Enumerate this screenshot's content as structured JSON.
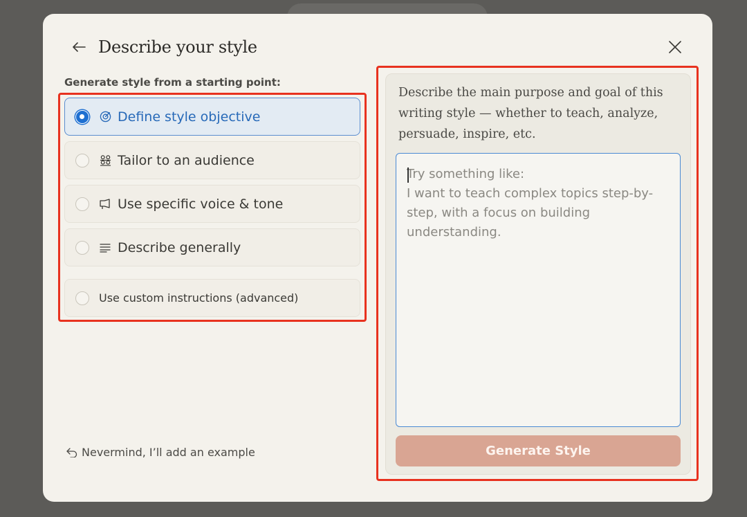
{
  "header": {
    "title": "Describe your style",
    "back_icon": "arrow-left-icon",
    "close_icon": "close-icon"
  },
  "left": {
    "section_label": "Generate style from a starting point:",
    "options": [
      {
        "label": "Define style objective",
        "icon": "target-icon",
        "selected": true
      },
      {
        "label": "Tailor to an audience",
        "icon": "audience-icon",
        "selected": false
      },
      {
        "label": "Use specific voice & tone",
        "icon": "megaphone-icon",
        "selected": false
      },
      {
        "label": "Describe generally",
        "icon": "text-lines-icon",
        "selected": false
      },
      {
        "label": "Use custom instructions (advanced)",
        "icon": "",
        "selected": false
      }
    ],
    "nevermind": "Nevermind, I’ll add an example"
  },
  "right": {
    "description": "Describe the main purpose and goal of this writing style — whether to teach, analyze, persuade, inspire, etc.",
    "textarea_value": "",
    "textarea_placeholder": "Try something like:\nI want to teach complex topics step-by-step, with a focus on building understanding.",
    "generate_label": "Generate Style"
  },
  "colors": {
    "accent_blue": "#1e6fd1",
    "highlight_red": "#e8321f",
    "generate_button": "#d9a593"
  }
}
